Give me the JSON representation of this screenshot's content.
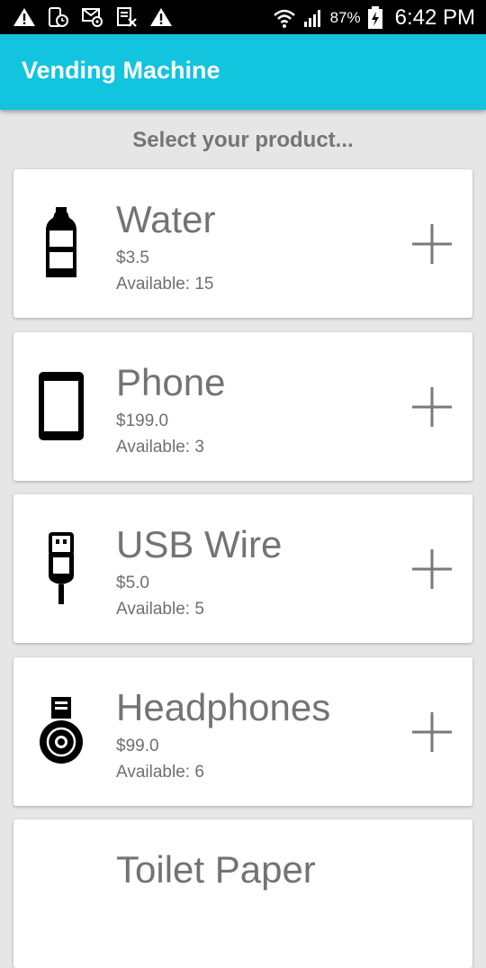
{
  "status_bar": {
    "battery_percent": "87%",
    "time": "6:42 PM",
    "icons": [
      "warning-icon",
      "phone-clock-icon",
      "mail-at-icon",
      "document-x-icon",
      "warning-icon",
      "wifi-icon",
      "signal-icon",
      "battery-charging-icon"
    ]
  },
  "app_bar": {
    "title": "Vending Machine",
    "color": "#12c4de"
  },
  "prompt": "Select your product...",
  "products": [
    {
      "name": "Water",
      "price": "$3.5",
      "available": "Available: 15",
      "icon": "water-bottle-icon"
    },
    {
      "name": "Phone",
      "price": "$199.0",
      "available": "Available: 3",
      "icon": "phone-icon"
    },
    {
      "name": "USB Wire",
      "price": "$5.0",
      "available": "Available: 5",
      "icon": "usb-wire-icon"
    },
    {
      "name": "Headphones",
      "price": "$99.0",
      "available": "Available: 6",
      "icon": "headphones-icon"
    },
    {
      "name": "Toilet Paper",
      "icon": "toilet-paper-icon"
    }
  ]
}
